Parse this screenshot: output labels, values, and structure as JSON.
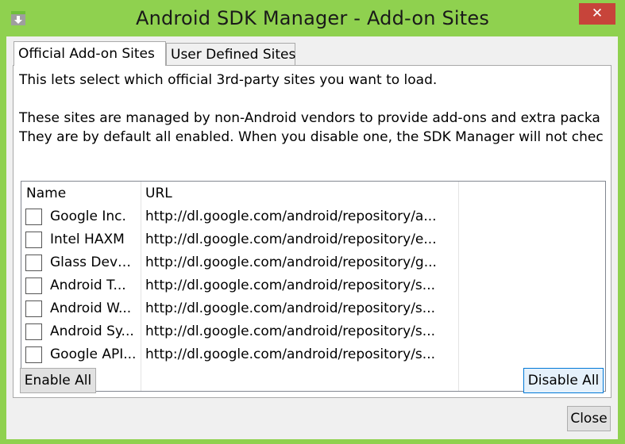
{
  "window": {
    "title": "Android SDK Manager - Add-on Sites",
    "close_glyph": "✕",
    "accent": "#8fd14f",
    "close_bg": "#c7443a"
  },
  "tabs": [
    {
      "label": "Official Add-on Sites",
      "active": true
    },
    {
      "label": "User Defined Sites",
      "active": false
    }
  ],
  "description": {
    "line1": "This lets select which official 3rd-party sites you want to load.",
    "line2": "These sites are managed by non-Android vendors to provide add-ons and extra packa",
    "line3": "They are by default all enabled. When you disable one, the SDK Manager will not chec"
  },
  "table": {
    "columns": [
      "Name",
      "URL"
    ],
    "rows": [
      {
        "checked": false,
        "name": "Google Inc.",
        "url": "http://dl.google.com/android/repository/a..."
      },
      {
        "checked": false,
        "name": "Intel HAXM",
        "url": "http://dl.google.com/android/repository/e..."
      },
      {
        "checked": false,
        "name": "Glass Devel...",
        "url": "http://dl.google.com/android/repository/g..."
      },
      {
        "checked": false,
        "name": "Android T...",
        "url": "http://dl.google.com/android/repository/s..."
      },
      {
        "checked": false,
        "name": "Android W...",
        "url": "http://dl.google.com/android/repository/s..."
      },
      {
        "checked": false,
        "name": "Android Sy...",
        "url": "http://dl.google.com/android/repository/s..."
      },
      {
        "checked": false,
        "name": "Google API...",
        "url": "http://dl.google.com/android/repository/s..."
      }
    ]
  },
  "buttons": {
    "enable_all": "Enable All",
    "disable_all": "Disable All",
    "close": "Close"
  }
}
